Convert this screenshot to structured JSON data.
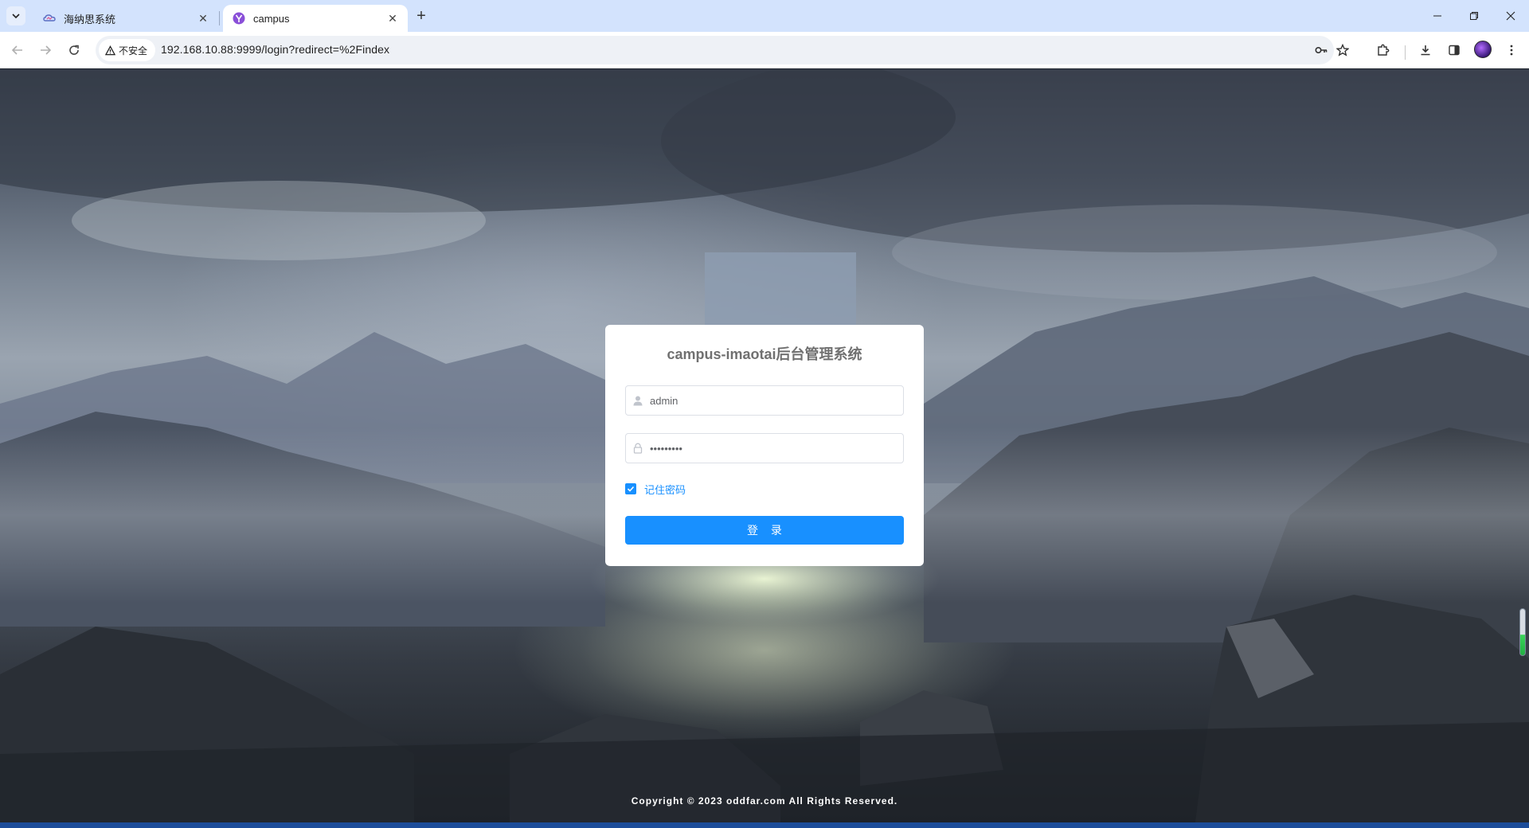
{
  "browser": {
    "tabs": [
      {
        "title": "海纳思系统",
        "icon": "cloud-icon",
        "active": false
      },
      {
        "title": "campus",
        "icon": "yoga-icon",
        "active": true
      }
    ],
    "security_label": "不安全",
    "url": "192.168.10.88:9999/login?redirect=%2Findex"
  },
  "login": {
    "title": "campus-imaotai后台管理系统",
    "username_value": "admin",
    "password_value": "•••••••••",
    "remember_label": "记住密码",
    "remember_checked": true,
    "submit_label": "登 录"
  },
  "footer": {
    "copyright": "Copyright © 2023 oddfar.com All Rights Reserved."
  },
  "colors": {
    "accent": "#1890ff",
    "tabbar": "#d3e3fd"
  }
}
